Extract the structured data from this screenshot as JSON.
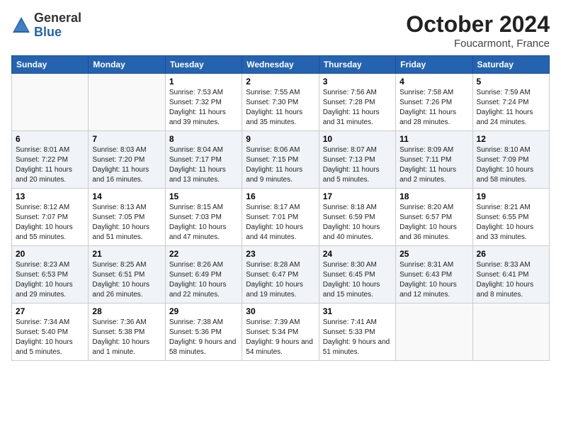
{
  "header": {
    "logo_general": "General",
    "logo_blue": "Blue",
    "month_title": "October 2024",
    "location": "Foucarmont, France"
  },
  "days_of_week": [
    "Sunday",
    "Monday",
    "Tuesday",
    "Wednesday",
    "Thursday",
    "Friday",
    "Saturday"
  ],
  "weeks": [
    [
      {
        "day": "",
        "sunrise": "",
        "sunset": "",
        "daylight": ""
      },
      {
        "day": "",
        "sunrise": "",
        "sunset": "",
        "daylight": ""
      },
      {
        "day": "1",
        "sunrise": "Sunrise: 7:53 AM",
        "sunset": "Sunset: 7:32 PM",
        "daylight": "Daylight: 11 hours and 39 minutes."
      },
      {
        "day": "2",
        "sunrise": "Sunrise: 7:55 AM",
        "sunset": "Sunset: 7:30 PM",
        "daylight": "Daylight: 11 hours and 35 minutes."
      },
      {
        "day": "3",
        "sunrise": "Sunrise: 7:56 AM",
        "sunset": "Sunset: 7:28 PM",
        "daylight": "Daylight: 11 hours and 31 minutes."
      },
      {
        "day": "4",
        "sunrise": "Sunrise: 7:58 AM",
        "sunset": "Sunset: 7:26 PM",
        "daylight": "Daylight: 11 hours and 28 minutes."
      },
      {
        "day": "5",
        "sunrise": "Sunrise: 7:59 AM",
        "sunset": "Sunset: 7:24 PM",
        "daylight": "Daylight: 11 hours and 24 minutes."
      }
    ],
    [
      {
        "day": "6",
        "sunrise": "Sunrise: 8:01 AM",
        "sunset": "Sunset: 7:22 PM",
        "daylight": "Daylight: 11 hours and 20 minutes."
      },
      {
        "day": "7",
        "sunrise": "Sunrise: 8:03 AM",
        "sunset": "Sunset: 7:20 PM",
        "daylight": "Daylight: 11 hours and 16 minutes."
      },
      {
        "day": "8",
        "sunrise": "Sunrise: 8:04 AM",
        "sunset": "Sunset: 7:17 PM",
        "daylight": "Daylight: 11 hours and 13 minutes."
      },
      {
        "day": "9",
        "sunrise": "Sunrise: 8:06 AM",
        "sunset": "Sunset: 7:15 PM",
        "daylight": "Daylight: 11 hours and 9 minutes."
      },
      {
        "day": "10",
        "sunrise": "Sunrise: 8:07 AM",
        "sunset": "Sunset: 7:13 PM",
        "daylight": "Daylight: 11 hours and 5 minutes."
      },
      {
        "day": "11",
        "sunrise": "Sunrise: 8:09 AM",
        "sunset": "Sunset: 7:11 PM",
        "daylight": "Daylight: 11 hours and 2 minutes."
      },
      {
        "day": "12",
        "sunrise": "Sunrise: 8:10 AM",
        "sunset": "Sunset: 7:09 PM",
        "daylight": "Daylight: 10 hours and 58 minutes."
      }
    ],
    [
      {
        "day": "13",
        "sunrise": "Sunrise: 8:12 AM",
        "sunset": "Sunset: 7:07 PM",
        "daylight": "Daylight: 10 hours and 55 minutes."
      },
      {
        "day": "14",
        "sunrise": "Sunrise: 8:13 AM",
        "sunset": "Sunset: 7:05 PM",
        "daylight": "Daylight: 10 hours and 51 minutes."
      },
      {
        "day": "15",
        "sunrise": "Sunrise: 8:15 AM",
        "sunset": "Sunset: 7:03 PM",
        "daylight": "Daylight: 10 hours and 47 minutes."
      },
      {
        "day": "16",
        "sunrise": "Sunrise: 8:17 AM",
        "sunset": "Sunset: 7:01 PM",
        "daylight": "Daylight: 10 hours and 44 minutes."
      },
      {
        "day": "17",
        "sunrise": "Sunrise: 8:18 AM",
        "sunset": "Sunset: 6:59 PM",
        "daylight": "Daylight: 10 hours and 40 minutes."
      },
      {
        "day": "18",
        "sunrise": "Sunrise: 8:20 AM",
        "sunset": "Sunset: 6:57 PM",
        "daylight": "Daylight: 10 hours and 36 minutes."
      },
      {
        "day": "19",
        "sunrise": "Sunrise: 8:21 AM",
        "sunset": "Sunset: 6:55 PM",
        "daylight": "Daylight: 10 hours and 33 minutes."
      }
    ],
    [
      {
        "day": "20",
        "sunrise": "Sunrise: 8:23 AM",
        "sunset": "Sunset: 6:53 PM",
        "daylight": "Daylight: 10 hours and 29 minutes."
      },
      {
        "day": "21",
        "sunrise": "Sunrise: 8:25 AM",
        "sunset": "Sunset: 6:51 PM",
        "daylight": "Daylight: 10 hours and 26 minutes."
      },
      {
        "day": "22",
        "sunrise": "Sunrise: 8:26 AM",
        "sunset": "Sunset: 6:49 PM",
        "daylight": "Daylight: 10 hours and 22 minutes."
      },
      {
        "day": "23",
        "sunrise": "Sunrise: 8:28 AM",
        "sunset": "Sunset: 6:47 PM",
        "daylight": "Daylight: 10 hours and 19 minutes."
      },
      {
        "day": "24",
        "sunrise": "Sunrise: 8:30 AM",
        "sunset": "Sunset: 6:45 PM",
        "daylight": "Daylight: 10 hours and 15 minutes."
      },
      {
        "day": "25",
        "sunrise": "Sunrise: 8:31 AM",
        "sunset": "Sunset: 6:43 PM",
        "daylight": "Daylight: 10 hours and 12 minutes."
      },
      {
        "day": "26",
        "sunrise": "Sunrise: 8:33 AM",
        "sunset": "Sunset: 6:41 PM",
        "daylight": "Daylight: 10 hours and 8 minutes."
      }
    ],
    [
      {
        "day": "27",
        "sunrise": "Sunrise: 7:34 AM",
        "sunset": "Sunset: 5:40 PM",
        "daylight": "Daylight: 10 hours and 5 minutes."
      },
      {
        "day": "28",
        "sunrise": "Sunrise: 7:36 AM",
        "sunset": "Sunset: 5:38 PM",
        "daylight": "Daylight: 10 hours and 1 minute."
      },
      {
        "day": "29",
        "sunrise": "Sunrise: 7:38 AM",
        "sunset": "Sunset: 5:36 PM",
        "daylight": "Daylight: 9 hours and 58 minutes."
      },
      {
        "day": "30",
        "sunrise": "Sunrise: 7:39 AM",
        "sunset": "Sunset: 5:34 PM",
        "daylight": "Daylight: 9 hours and 54 minutes."
      },
      {
        "day": "31",
        "sunrise": "Sunrise: 7:41 AM",
        "sunset": "Sunset: 5:33 PM",
        "daylight": "Daylight: 9 hours and 51 minutes."
      },
      {
        "day": "",
        "sunrise": "",
        "sunset": "",
        "daylight": ""
      },
      {
        "day": "",
        "sunrise": "",
        "sunset": "",
        "daylight": ""
      }
    ]
  ]
}
